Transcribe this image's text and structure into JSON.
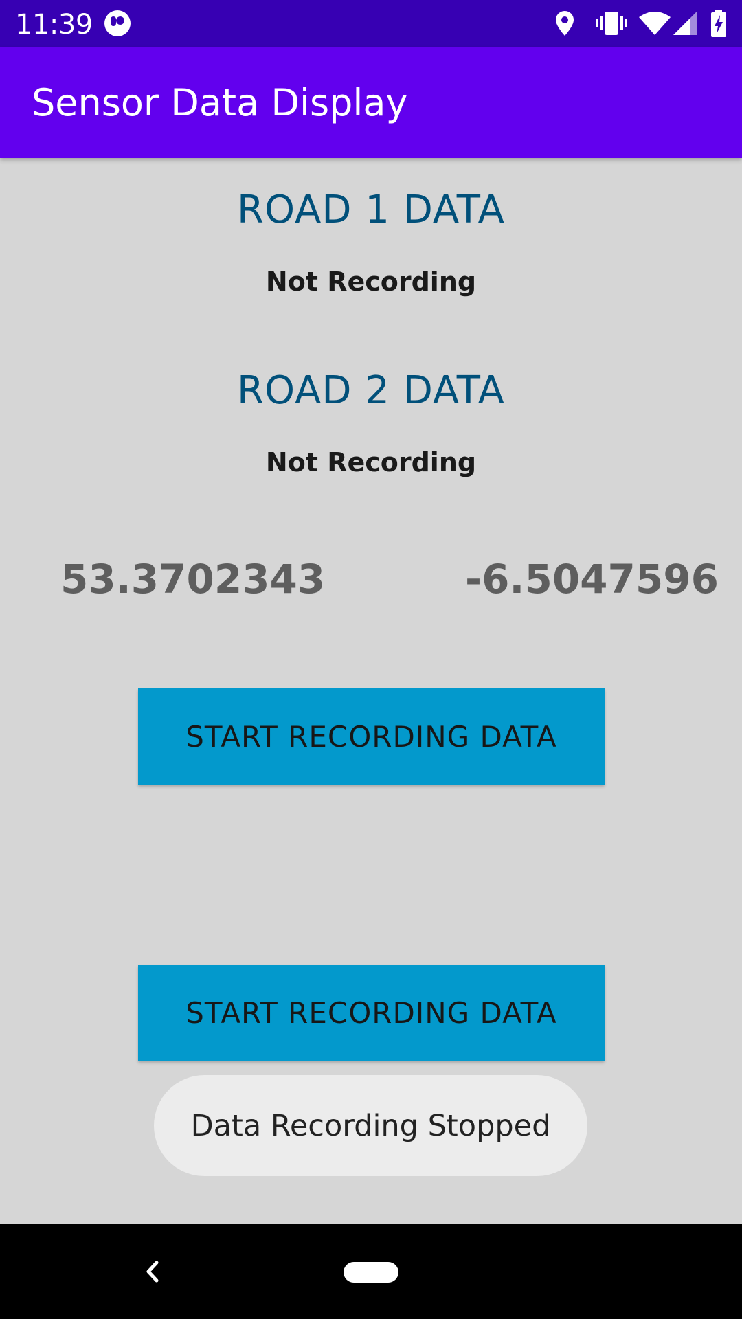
{
  "status_bar": {
    "time": "11:39",
    "icons": [
      "pill-icon",
      "location-icon",
      "vibrate-icon",
      "wifi-icon",
      "signal-icon",
      "battery-charging-icon"
    ]
  },
  "app_bar": {
    "title": "Sensor Data Display"
  },
  "road1": {
    "header": "ROAD 1 DATA",
    "status": "Not Recording"
  },
  "road2": {
    "header": "ROAD 2 DATA",
    "status": "Not Recording"
  },
  "location": {
    "latitude": "53.3702343",
    "longitude": "-6.5047596"
  },
  "buttons": {
    "record1_label": "START RECORDING DATA",
    "record2_label": "START RECORDING DATA"
  },
  "toast": {
    "message": "Data Recording Stopped"
  },
  "nav_bar": {
    "icons": [
      "back-icon",
      "home-pill-icon"
    ]
  },
  "colors": {
    "status_bar": "#3700b3",
    "app_bar": "#6200ee",
    "accent_blue": "#0399cc",
    "background": "#d6d6d6",
    "header_text": "#01507a"
  }
}
